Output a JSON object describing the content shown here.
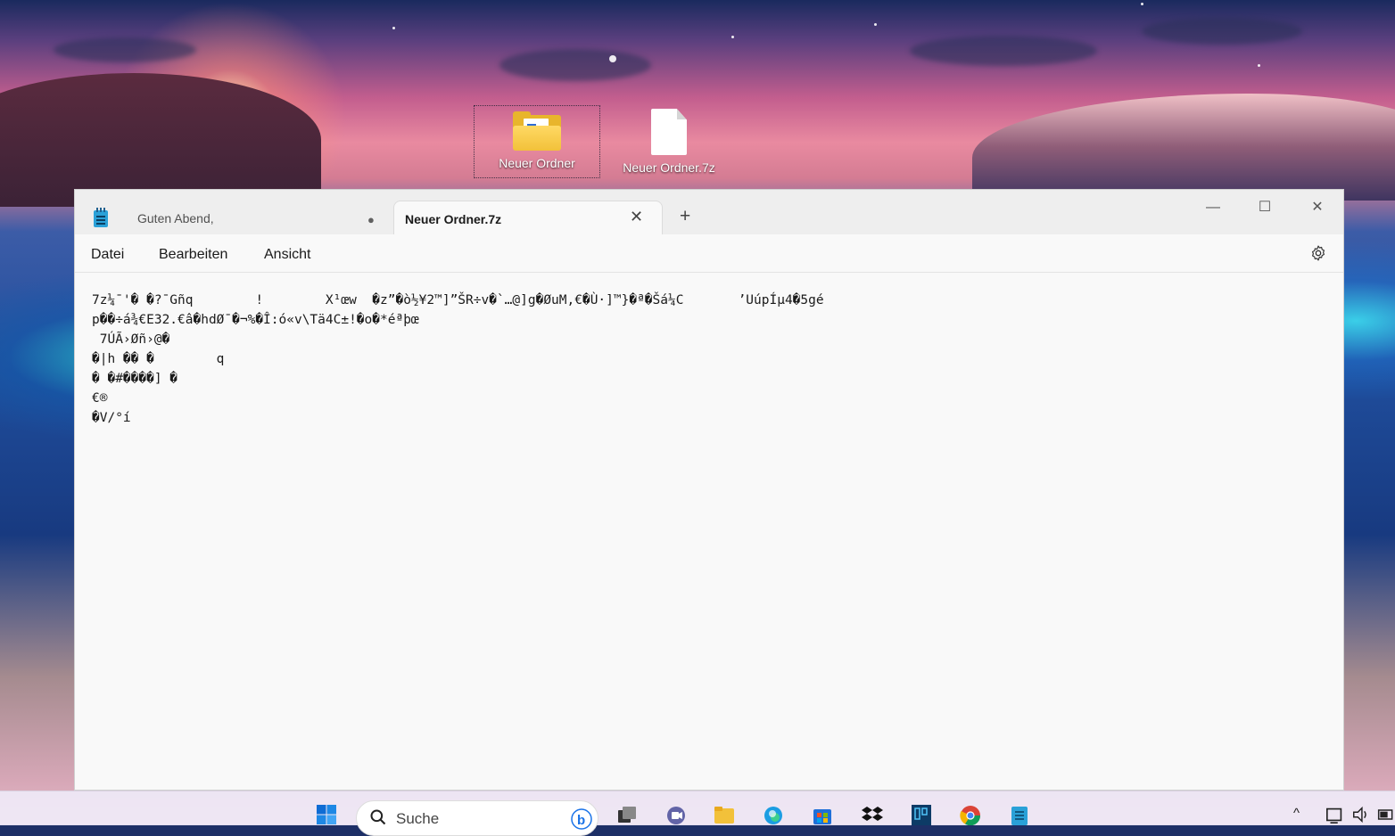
{
  "desktop": {
    "icons": [
      {
        "label": "Neuer Ordner",
        "icon": "folder-icon",
        "selected": true
      },
      {
        "label": "Neuer Ordner.7z",
        "icon": "file-icon",
        "selected": false
      }
    ]
  },
  "notepad": {
    "app_icon": "notepad-icon",
    "tabs": [
      {
        "title": "Guten Abend,",
        "state": "unsaved-dot",
        "active": false
      },
      {
        "title": "Neuer Ordner.7z",
        "state": "close",
        "active": true
      }
    ],
    "tab_close_symbol": "✕",
    "tab_unsaved_symbol": "●",
    "new_tab_symbol": "+",
    "window_controls": {
      "minimize": "—",
      "maximize": "☐",
      "close": "✕"
    },
    "menu": [
      "Datei",
      "Bearbeiten",
      "Ansicht"
    ],
    "settings_icon": "gear-icon",
    "content_lines": [
      "7z¼¯'� �?¯Gñq        !        X¹œw  �z”�ò½¥2™]”ŠR÷v�`…@]g�ØuM,€�Ù·]™}�ª�Šá¼C       ’UúpÍµ4�5gé",
      "p��÷á¾€E32.€â�hdØ¯�¬%�Î:ó«v\\Tä4C±!�o�*éªþœ",
      " 7ÚÃ›Øñ›@�",
      "�|h �� �        q",
      "� �#����] �",
      "€®",
      "�V/°í"
    ]
  },
  "taskbar": {
    "start_icon": "windows-start-icon",
    "search_placeholder": "Suche",
    "pinned": [
      "task-view-icon",
      "teams-icon",
      "file-explorer-icon",
      "edge-icon",
      "store-icon",
      "dropbox-icon",
      "app-icon",
      "chrome-icon",
      "notepad-icon"
    ],
    "tray": {
      "chevron": "^"
    }
  },
  "colors": {
    "accent": "#0067c0",
    "folder": "#f2c13a",
    "notepad_blue": "#2aa1d8",
    "window_bg": "#f9f9f9",
    "titlebar_bg": "#eeeeee"
  }
}
